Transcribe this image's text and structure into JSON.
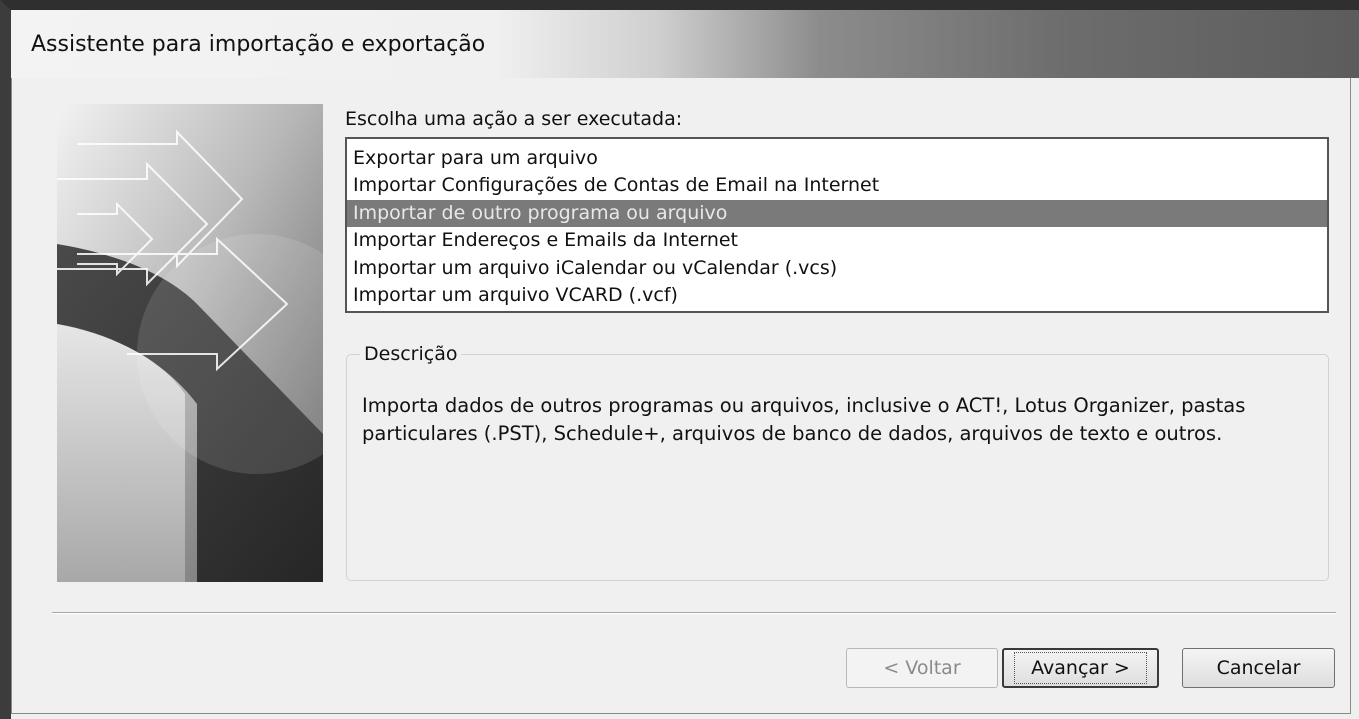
{
  "window": {
    "title": "Assistente para importação e exportação"
  },
  "action_prompt": "Escolha uma ação a ser executada:",
  "actions": {
    "items": [
      {
        "label": "Exportar para um arquivo"
      },
      {
        "label": "Importar Configurações de Contas de Email na Internet"
      },
      {
        "label": "Importar de outro programa ou arquivo"
      },
      {
        "label": "Importar Endereços e Emails da Internet"
      },
      {
        "label": "Importar um arquivo iCalendar ou vCalendar (.vcs)"
      },
      {
        "label": "Importar um arquivo VCARD (.vcf)"
      }
    ],
    "selected_index": 2
  },
  "description": {
    "legend": "Descrição",
    "text": "Importa dados de outros programas ou arquivos, inclusive o ACT!, Lotus Organizer, pastas particulares (.PST), Schedule+, arquivos de banco de dados, arquivos de texto e outros."
  },
  "buttons": {
    "back": "< Voltar",
    "next": "Avançar >",
    "cancel": "Cancelar"
  },
  "colors": {
    "selection": "#7a7a7a",
    "dialog_background": "#f0f0f0"
  },
  "icons": {
    "wizard_art": "arrows-graphic"
  }
}
